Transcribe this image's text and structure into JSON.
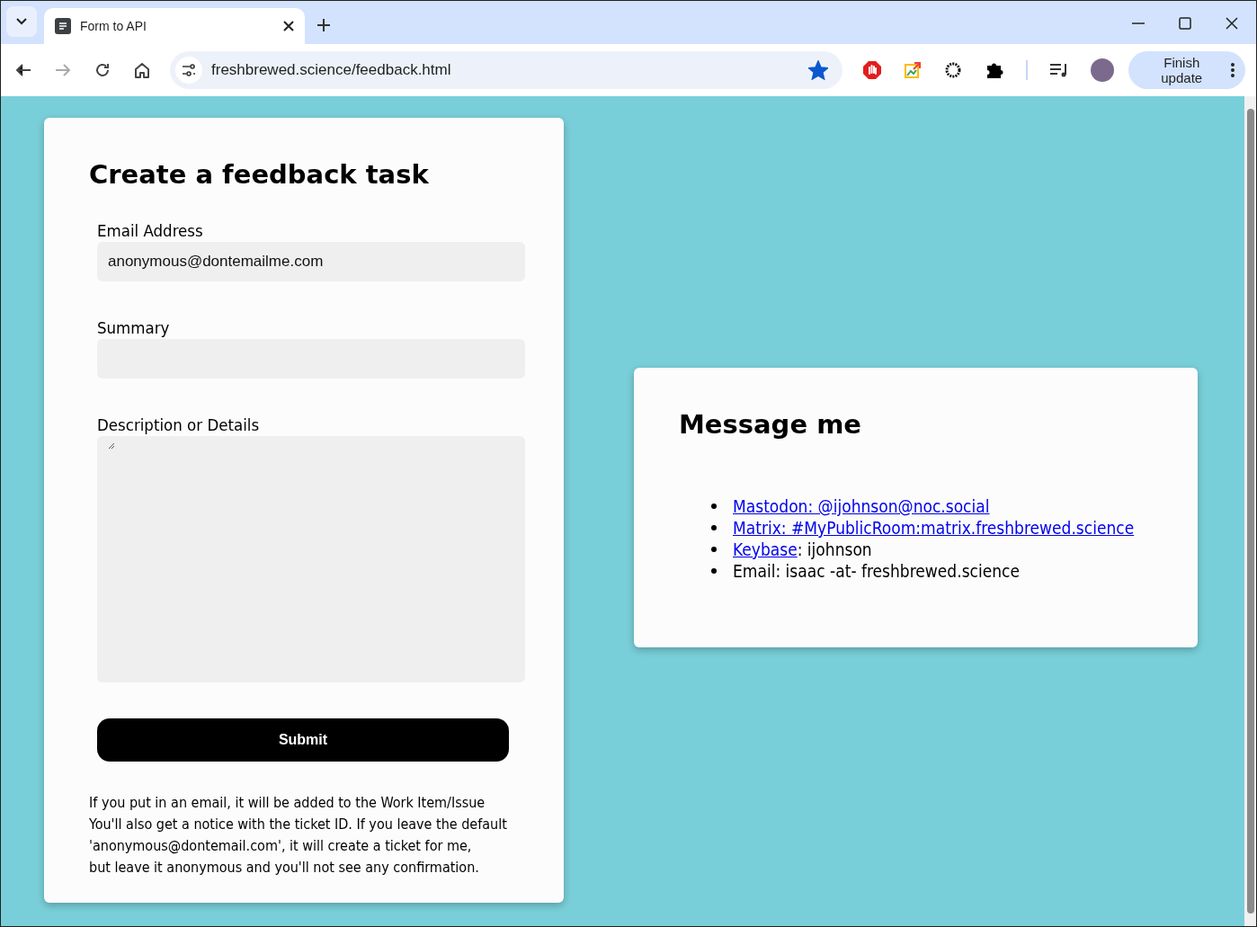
{
  "browser": {
    "tab_title": "Form to API",
    "url": "freshbrewed.science/feedback.html",
    "bookmarked": true,
    "update_button": "Finish update"
  },
  "form": {
    "title": "Create a feedback task",
    "fields": [
      {
        "kind": "input",
        "label": "Email Address",
        "value": "anonymous@dontemailme.com"
      },
      {
        "kind": "input",
        "label": "Summary"
      },
      {
        "kind": "textarea",
        "label": "Description or Details"
      }
    ],
    "submit": "Submit",
    "note_lines": [
      "If you put in an email, it will be added to the Work Item/Issue",
      "You'll also get a notice with the ticket ID. If you leave the default",
      "'anonymous@dontemail.com', it will create a ticket for me,",
      "but leave it anonymous and you'll not see any confirmation."
    ]
  },
  "contact": {
    "title": "Message me",
    "items": [
      {
        "link": "Mastodon: @ijohnson@noc.social"
      },
      {
        "link": "Matrix: #MyPublicRoom:matrix.freshbrewed.science"
      },
      {
        "link": "Keybase",
        "text": ": ijohnson"
      },
      {
        "text": "Email: isaac -at- freshbrewed.science"
      }
    ]
  }
}
